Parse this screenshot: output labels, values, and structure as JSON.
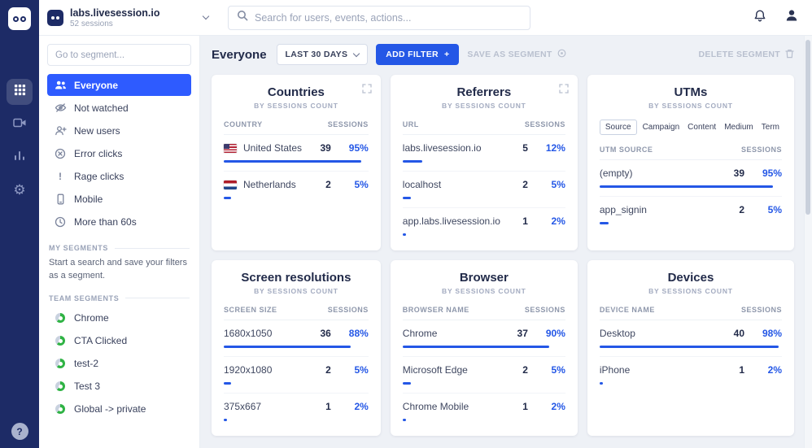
{
  "icons": {
    "help_glyph": "?",
    "rage_glyph": "!",
    "gear_glyph": "⚙"
  },
  "topbar": {
    "workspace_name": "labs.livesession.io",
    "workspace_sessions": "52 sessions",
    "search_placeholder": "Search for users, events, actions..."
  },
  "sidebar": {
    "search_placeholder": "Go to segment...",
    "segments": [
      {
        "label": "Everyone"
      },
      {
        "label": "Not watched"
      },
      {
        "label": "New users"
      },
      {
        "label": "Error clicks"
      },
      {
        "label": "Rage clicks"
      },
      {
        "label": "Mobile"
      },
      {
        "label": "More than 60s"
      }
    ],
    "my_segments_header": "MY SEGMENTS",
    "my_segments_empty": "Start a search and save your filters as a segment.",
    "team_segments_header": "TEAM SEGMENTS",
    "team_segments": [
      {
        "label": "Chrome"
      },
      {
        "label": "CTA Clicked"
      },
      {
        "label": "test-2"
      },
      {
        "label": "Test 3"
      },
      {
        "label": "Global -> private"
      }
    ]
  },
  "filterbar": {
    "segment_name": "Everyone",
    "date_range": "LAST 30 DAYS",
    "add_filter": "ADD FILTER",
    "add_filter_plus": "+",
    "save_as_segment": "SAVE AS SEGMENT",
    "delete_segment": "DELETE SEGMENT"
  },
  "cards": [
    {
      "title": "Countries",
      "subtitle": "BY SESSIONS COUNT",
      "col_left": "COUNTRY",
      "col_right": "SESSIONS",
      "rows": [
        {
          "label": "United States",
          "flag": "us",
          "sessions": "39",
          "percent": "95%",
          "bar": 95
        },
        {
          "label": "Netherlands",
          "flag": "nl",
          "sessions": "2",
          "percent": "5%",
          "bar": 5
        }
      ]
    },
    {
      "title": "Referrers",
      "subtitle": "BY SESSIONS COUNT",
      "col_left": "URL",
      "col_right": "SESSIONS",
      "rows": [
        {
          "label": "labs.livesession.io",
          "sessions": "5",
          "percent": "12%",
          "bar": 12
        },
        {
          "label": "localhost",
          "sessions": "2",
          "percent": "5%",
          "bar": 5
        },
        {
          "label": "app.labs.livesession.io",
          "sessions": "1",
          "percent": "2%",
          "bar": 2
        }
      ]
    },
    {
      "title": "UTMs",
      "subtitle": "BY SESSIONS COUNT",
      "tabs": [
        {
          "label": "Source"
        },
        {
          "label": "Campaign"
        },
        {
          "label": "Content"
        },
        {
          "label": "Medium"
        },
        {
          "label": "Term"
        }
      ],
      "col_left": "UTM SOURCE",
      "col_right": "SESSIONS",
      "rows": [
        {
          "label": "(empty)",
          "sessions": "39",
          "percent": "95%",
          "bar": 95
        },
        {
          "label": "app_signin",
          "sessions": "2",
          "percent": "5%",
          "bar": 5
        }
      ]
    },
    {
      "title": "Screen resolutions",
      "subtitle": "BY SESSIONS COUNT",
      "col_left": "SCREEN SIZE",
      "col_right": "SESSIONS",
      "rows": [
        {
          "label": "1680x1050",
          "sessions": "36",
          "percent": "88%",
          "bar": 88
        },
        {
          "label": "1920x1080",
          "sessions": "2",
          "percent": "5%",
          "bar": 5
        },
        {
          "label": "375x667",
          "sessions": "1",
          "percent": "2%",
          "bar": 2
        }
      ]
    },
    {
      "title": "Browser",
      "subtitle": "BY SESSIONS COUNT",
      "col_left": "BROWSER NAME",
      "col_right": "SESSIONS",
      "rows": [
        {
          "label": "Chrome",
          "sessions": "37",
          "percent": "90%",
          "bar": 90
        },
        {
          "label": "Microsoft Edge",
          "sessions": "2",
          "percent": "5%",
          "bar": 5
        },
        {
          "label": "Chrome Mobile",
          "sessions": "1",
          "percent": "2%",
          "bar": 2
        }
      ]
    },
    {
      "title": "Devices",
      "subtitle": "BY SESSIONS COUNT",
      "col_left": "DEVICE NAME",
      "col_right": "SESSIONS",
      "rows": [
        {
          "label": "Desktop",
          "sessions": "40",
          "percent": "98%",
          "bar": 98
        },
        {
          "label": "iPhone",
          "sessions": "1",
          "percent": "2%",
          "bar": 2
        }
      ]
    }
  ]
}
